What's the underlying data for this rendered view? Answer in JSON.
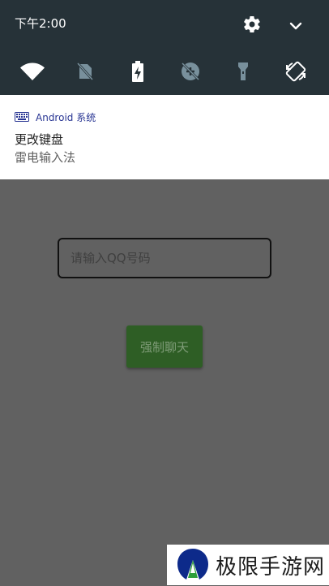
{
  "status": {
    "time": "下午2:00",
    "icons": [
      "gear-icon",
      "chevron-down-icon"
    ]
  },
  "quick_tiles": [
    {
      "name": "wifi-icon"
    },
    {
      "name": "sim-off-icon"
    },
    {
      "name": "battery-charging-icon"
    },
    {
      "name": "data-saver-off-icon"
    },
    {
      "name": "flashlight-icon"
    },
    {
      "name": "auto-rotate-icon"
    }
  ],
  "notification": {
    "app_name": "Android 系统",
    "title": "更改键盘",
    "text": "雷电输入法"
  },
  "app": {
    "qq_placeholder": "请输入QQ号码",
    "force_chat_label": "强制聊天"
  },
  "watermark": {
    "text": "极限手游网"
  },
  "colors": {
    "qs_background": "#263238",
    "scrim": "#616161",
    "button": "#2e5e25",
    "app_name": "#283593"
  }
}
